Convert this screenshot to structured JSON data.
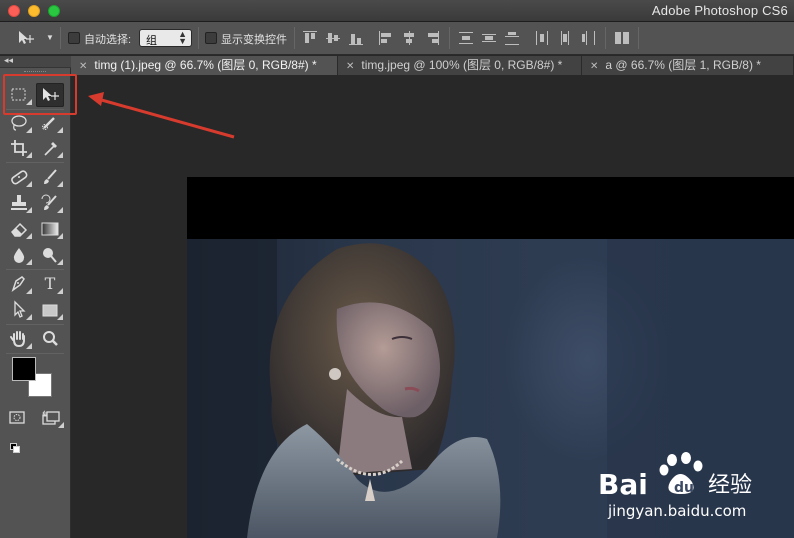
{
  "window": {
    "title": "Adobe Photoshop CS6"
  },
  "options_bar": {
    "auto_select_label": "自动选择:",
    "auto_select_value": "组",
    "show_transform_label": "显示变换控件"
  },
  "tabs": [
    {
      "label": "timg (1).jpeg @ 66.7% (图层 0, RGB/8#) *",
      "active": true
    },
    {
      "label": "timg.jpeg @ 100% (图层 0, RGB/8#) *",
      "active": false
    },
    {
      "label": "a @ 66.7% (图层 1, RGB/8) *",
      "active": false
    }
  ],
  "toolbar": {
    "tools": [
      "marquee",
      "move",
      "lasso",
      "quick-select",
      "crop",
      "eyedropper",
      "healing-brush",
      "brush",
      "clone-stamp",
      "history-brush",
      "eraser",
      "gradient",
      "blur",
      "dodge",
      "pen",
      "type",
      "path-select",
      "rectangle",
      "hand",
      "zoom"
    ],
    "type_glyph": "T",
    "foreground_color": "#000000",
    "background_color": "#ffffff"
  },
  "annotation": {
    "color": "#d63b2d"
  },
  "watermark": {
    "logo_text_left": "Bai",
    "logo_text_du": "du",
    "logo_text_right": "经验",
    "url": "jingyan.baidu.com"
  }
}
